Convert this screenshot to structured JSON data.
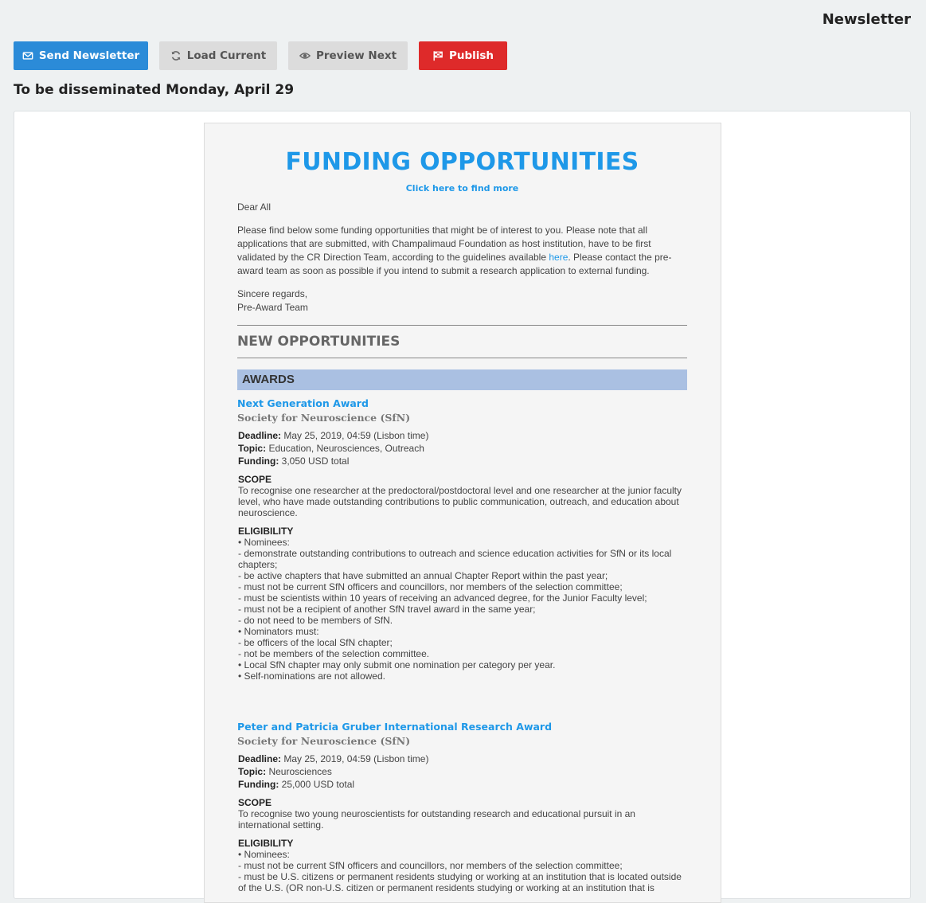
{
  "header": {
    "title": "Newsletter"
  },
  "toolbar": {
    "send": "Send Newsletter",
    "load": "Load Current",
    "preview": "Preview Next",
    "publish": "Publish"
  },
  "dissemination": "To be disseminated Monday, April 29",
  "newsletter": {
    "headline": "FUNDING OPPORTUNITIES",
    "find_more": "Click here to find more",
    "greeting": "Dear All",
    "intro_1": "Please find below some funding opportunities that might be of interest to you. Please note that all applications that are submitted, with Champalimaud Foundation as host institution, have to be first validated by the CR Direction Team, according to the guidelines available ",
    "intro_link": "here",
    "intro_2": ". Please contact the pre-award team as soon as possible if you intend to submit a research application to external funding.",
    "regards": "Sincere regards,",
    "team": "Pre-Award Team",
    "section": "NEW OPPORTUNITIES",
    "category": "AWARDS",
    "opportunities": [
      {
        "title": "Next Generation Award",
        "org": "Society for Neuroscience (SfN)",
        "deadline_label": "Deadline:",
        "deadline": "May 25, 2019, 04:59 (Lisbon time)",
        "topic_label": "Topic:",
        "topic": "Education, Neurosciences, Outreach",
        "funding_label": "Funding:",
        "funding": "3,050 USD total",
        "scope_label": "SCOPE",
        "scope": "To recognise one researcher at the predoctoral/postdoctoral level and one researcher at the junior faculty level, who have made outstanding contributions to public communication, outreach, and education about neuroscience.",
        "eligibility_label": "ELIGIBILITY",
        "eligibility": [
          "• Nominees:",
          "- demonstrate outstanding contributions to outreach and science education activities for SfN or its local chapters;",
          "- be active chapters that have submitted an annual Chapter Report within the past year;",
          "- must not be current SfN officers and councillors, nor members of the selection committee;",
          "- must be scientists within 10 years of receiving an advanced degree, for the Junior Faculty level;",
          "- must not be a recipient of another SfN travel award in the same year;",
          "- do not need to be members of SfN.",
          "• Nominators must:",
          "- be officers of the local SfN chapter;",
          "- not be members of the selection committee.",
          "• Local SfN chapter may only submit one nomination per category per year.",
          "• Self-nominations are not allowed."
        ]
      },
      {
        "title": "Peter and Patricia Gruber International Research Award",
        "org": "Society for Neuroscience (SfN)",
        "deadline_label": "Deadline:",
        "deadline": "May 25, 2019, 04:59 (Lisbon time)",
        "topic_label": "Topic:",
        "topic": "Neurosciences",
        "funding_label": "Funding:",
        "funding": "25,000 USD total",
        "scope_label": "SCOPE",
        "scope": "To recognise two young neuroscientists for outstanding research and educational pursuit in an international setting.",
        "eligibility_label": "ELIGIBILITY",
        "eligibility": [
          "• Nominees:",
          "- must not be current SfN officers and councillors, nor members of the selection committee;",
          "- must be U.S. citizens or permanent residents studying or working at an institution that is located outside of the U.S. (OR non-U.S. citizen or permanent residents studying or working at an institution that is"
        ]
      }
    ]
  }
}
